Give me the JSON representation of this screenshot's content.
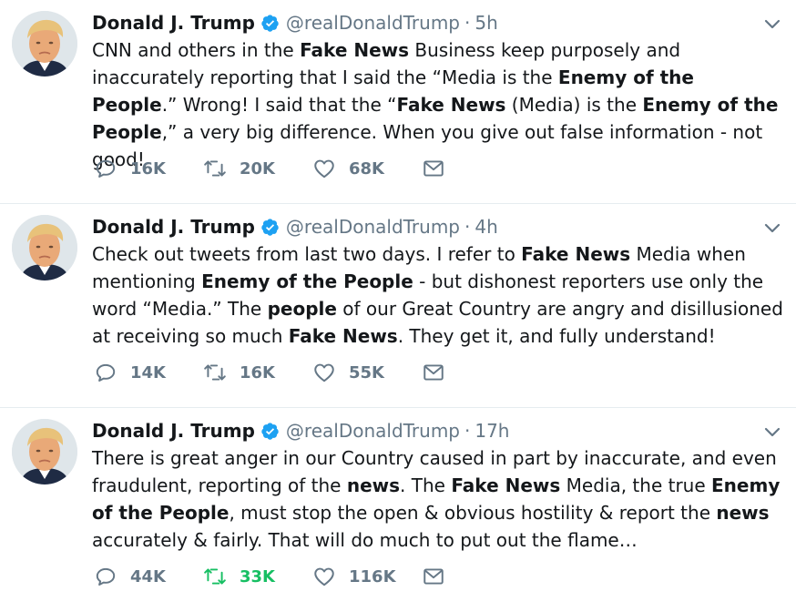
{
  "tweets": [
    {
      "author": "Donald J. Trump",
      "handle": "@realDonaldTrump",
      "separator": "·",
      "time": "5h",
      "text_parts": [
        {
          "t": "CNN and others in the ",
          "b": false
        },
        {
          "t": "Fake News",
          "b": true
        },
        {
          "t": " Business keep purposely and inaccurately reporting that I said the “Media is the ",
          "b": false
        },
        {
          "t": "Enemy of the People",
          "b": true
        },
        {
          "t": ".” Wrong! I said that the “",
          "b": false
        },
        {
          "t": "Fake News",
          "b": true
        },
        {
          "t": " (Media) is the ",
          "b": false
        },
        {
          "t": "Enemy of the People",
          "b": true
        },
        {
          "t": ",” a very big difference. When you give out false information - not good!",
          "b": false
        }
      ],
      "replies": "16K",
      "retweets": "20K",
      "likes": "68K",
      "retweeted": false
    },
    {
      "author": "Donald J. Trump",
      "handle": "@realDonaldTrump",
      "separator": "·",
      "time": "4h",
      "text_parts": [
        {
          "t": "Check out tweets from last two days. I refer to ",
          "b": false
        },
        {
          "t": "Fake News",
          "b": true
        },
        {
          "t": " Media when mentioning ",
          "b": false
        },
        {
          "t": "Enemy of the People",
          "b": true
        },
        {
          "t": " - but dishonest reporters use only the word “Media.” The ",
          "b": false
        },
        {
          "t": "people",
          "b": true
        },
        {
          "t": " of our Great Country are angry and disillusioned at receiving so much ",
          "b": false
        },
        {
          "t": "Fake News",
          "b": true
        },
        {
          "t": ". They get it, and fully understand!",
          "b": false
        }
      ],
      "replies": "14K",
      "retweets": "16K",
      "likes": "55K",
      "retweeted": false
    },
    {
      "author": "Donald J. Trump",
      "handle": "@realDonaldTrump",
      "separator": "·",
      "time": "17h",
      "text_parts": [
        {
          "t": "There is great anger in our Country caused in part by inaccurate, and even fraudulent, reporting of the ",
          "b": false
        },
        {
          "t": "news",
          "b": true
        },
        {
          "t": ". The ",
          "b": false
        },
        {
          "t": "Fake News",
          "b": true
        },
        {
          "t": " Media, the true ",
          "b": false
        },
        {
          "t": "Enemy of the People",
          "b": true
        },
        {
          "t": ", must stop the open & obvious hostility & report the ",
          "b": false
        },
        {
          "t": "news",
          "b": true
        },
        {
          "t": " accurately & fairly. That will do much to put out the flame…",
          "b": false
        }
      ],
      "replies": "44K",
      "retweets": "33K",
      "likes": "116K",
      "retweeted": true
    }
  ],
  "colors": {
    "text": "#14171a",
    "muted": "#657786",
    "verified": "#1da1f2",
    "retweet_active": "#17bf63",
    "divider": "#e6ecf0"
  },
  "icons": {
    "reply": "reply-icon",
    "retweet": "retweet-icon",
    "like": "heart-icon",
    "message": "envelope-icon",
    "verified": "verified-badge-icon",
    "caret": "chevron-down-icon"
  }
}
